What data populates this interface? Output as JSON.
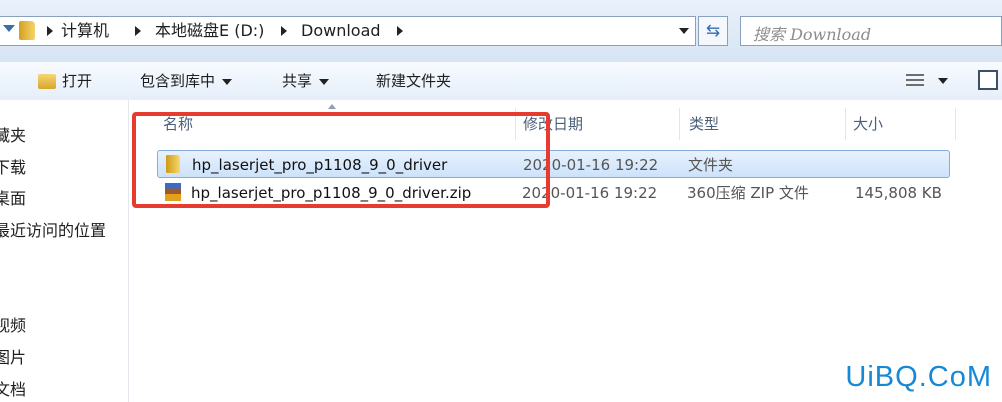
{
  "address_bar": {
    "crumbs": [
      "计算机",
      "本地磁盘E (D:)",
      "Download"
    ]
  },
  "search": {
    "placeholder": "搜索 Download"
  },
  "toolbar": {
    "open": "打开",
    "include_in_library": "包含到库中",
    "share": "共享",
    "new_folder": "新建文件夹"
  },
  "nav_pane": {
    "items": [
      "藏夹",
      "下载",
      "桌面",
      "最近访问的位置",
      "视频",
      "图片",
      "文档"
    ]
  },
  "columns": {
    "name": "名称",
    "modified": "修改日期",
    "type": "类型",
    "size": "大小"
  },
  "files": [
    {
      "name": "hp_laserjet_pro_p1108_9_0_driver",
      "modified": "2020-01-16 19:22",
      "type": "文件夹",
      "size": "",
      "icon": "folder-icon",
      "selected": true
    },
    {
      "name": "hp_laserjet_pro_p1108_9_0_driver.zip",
      "modified": "2020-01-16 19:22",
      "type": "360压缩 ZIP 文件",
      "size": "145,808 KB",
      "icon": "zip-archive-icon",
      "selected": false
    }
  ],
  "highlight_color": "#e63b2e",
  "watermark": "UiBQ.CoM"
}
